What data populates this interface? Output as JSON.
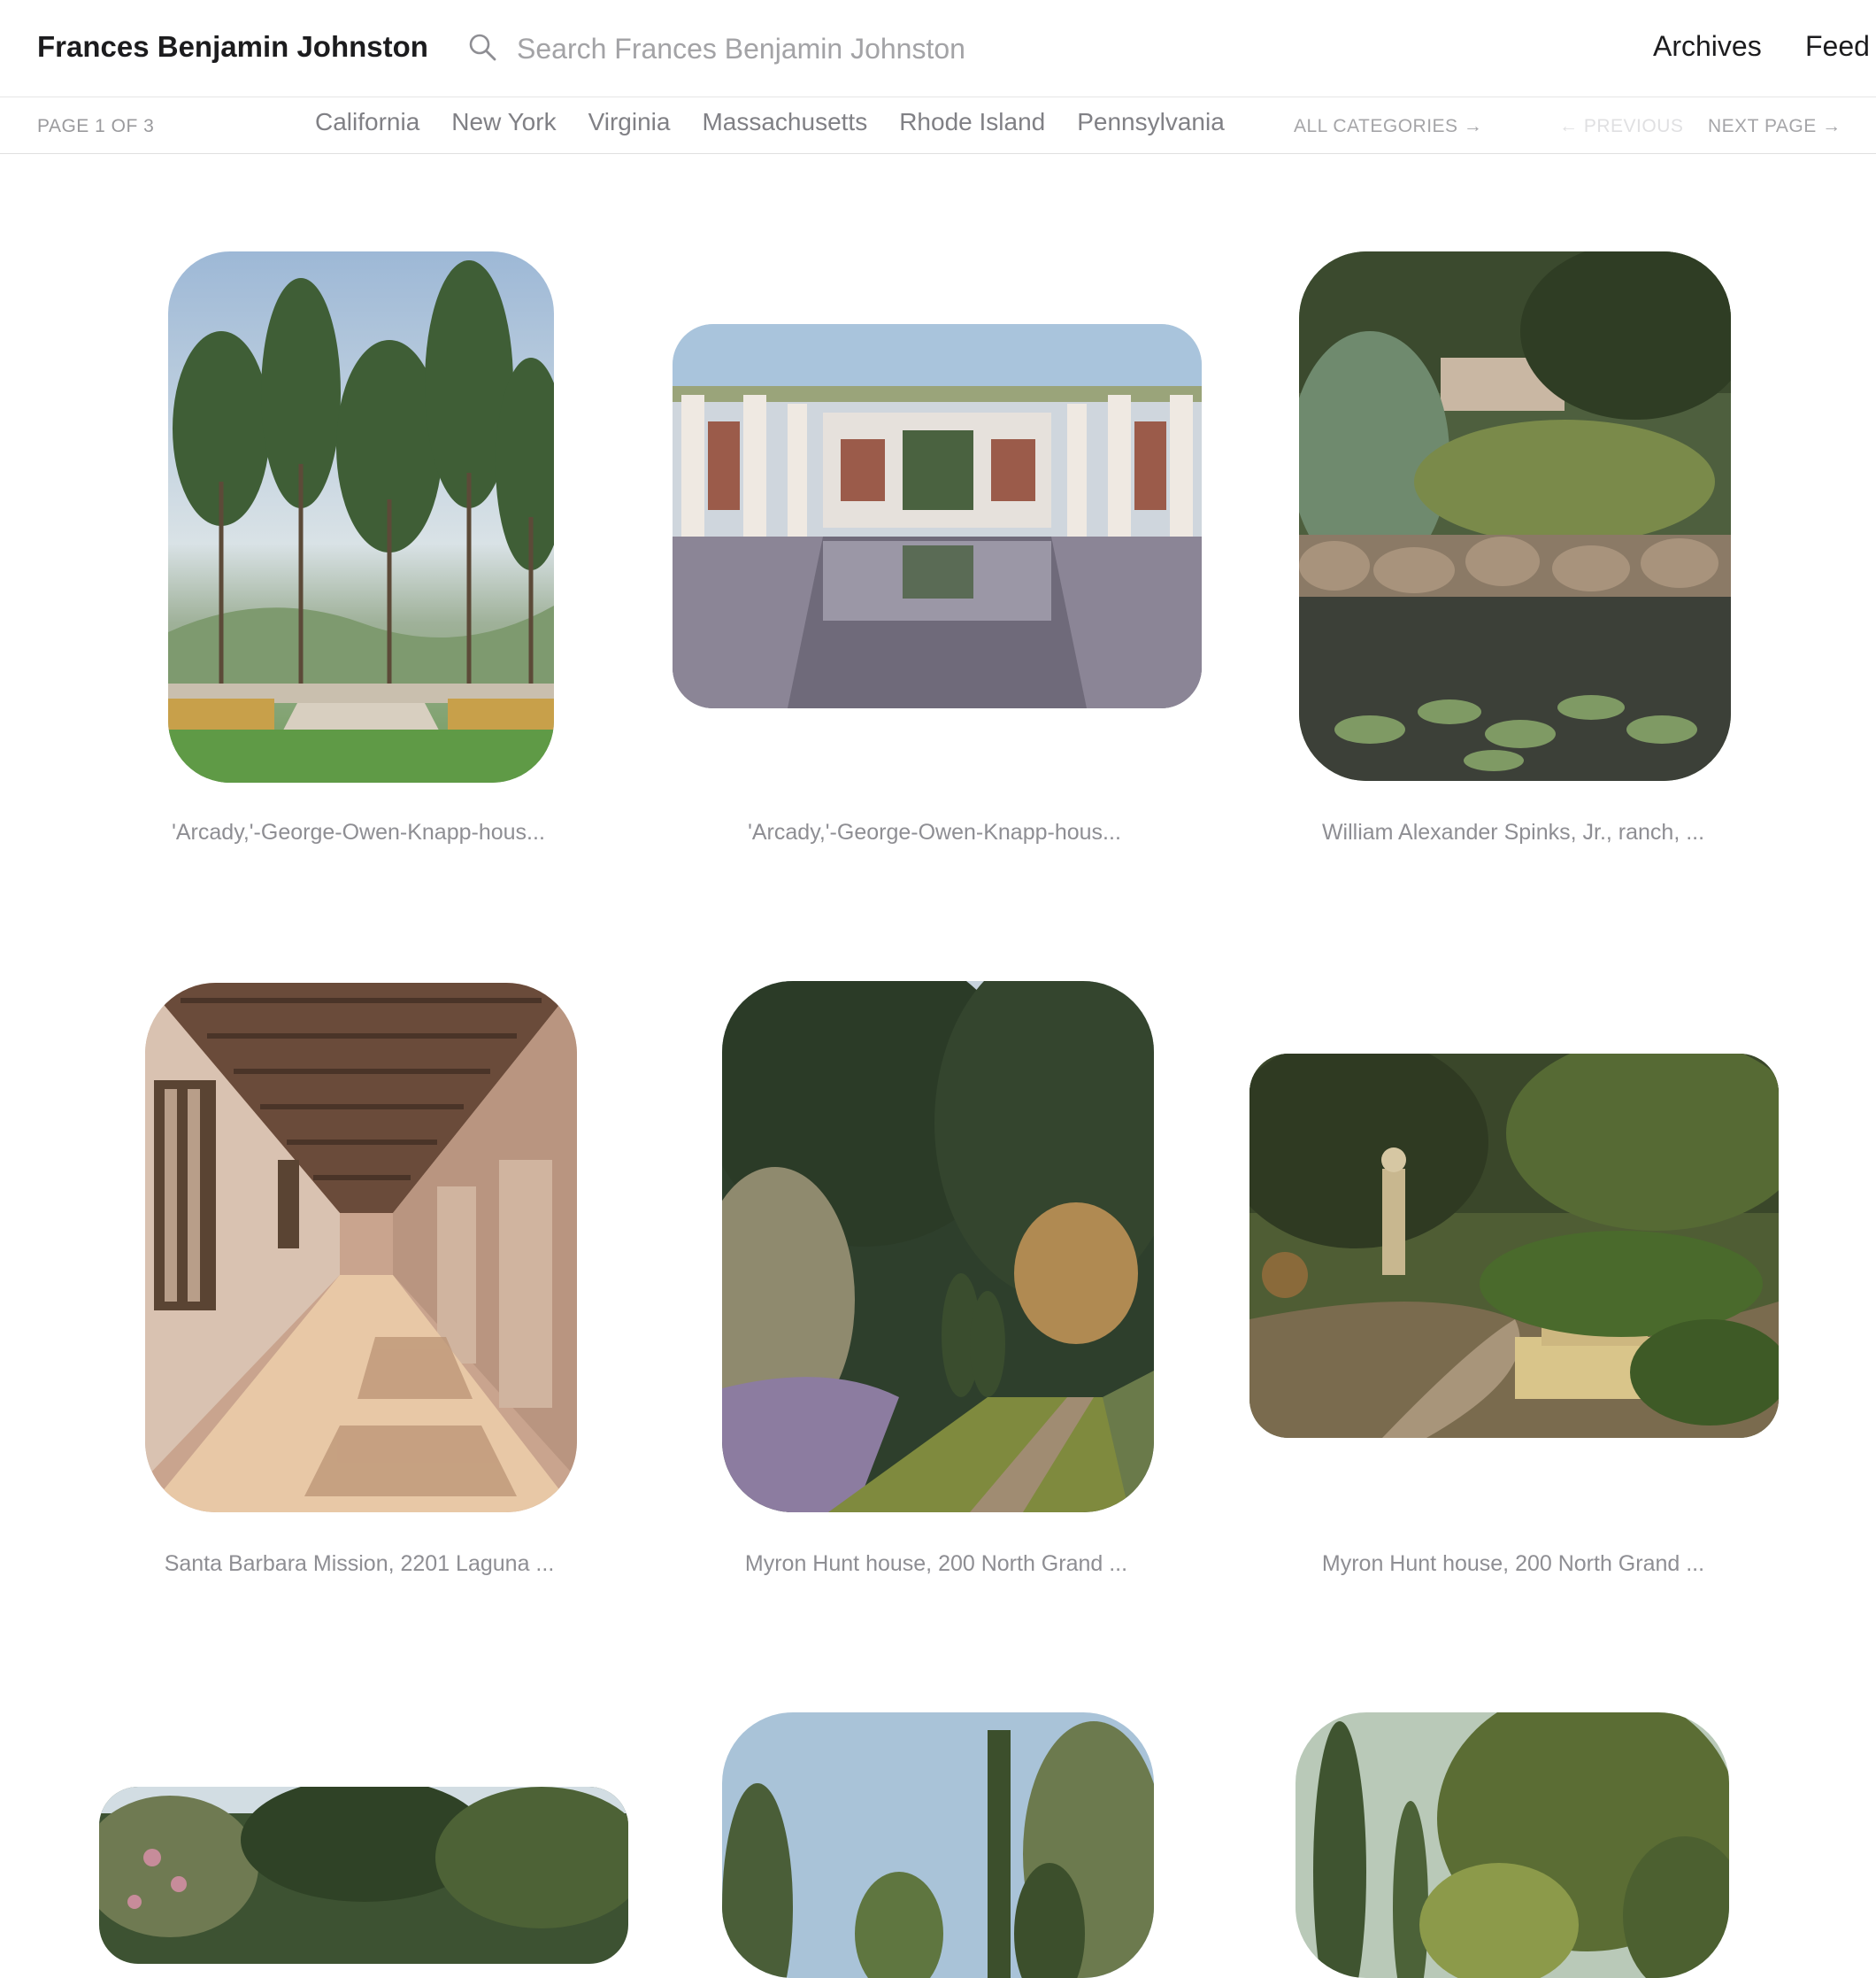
{
  "header": {
    "site_title": "Frances Benjamin Johnston",
    "search_placeholder": "Search Frances Benjamin Johnston",
    "links": [
      "Archives",
      "Feed"
    ]
  },
  "subnav": {
    "page_indicator": "PAGE 1 OF 3",
    "categories": [
      "California",
      "New York",
      "Virginia",
      "Massachusetts",
      "Rhode Island",
      "Pennsylvania"
    ],
    "all_categories": "ALL CATEGORIES →",
    "previous": "← PREVIOUS",
    "next": "NEXT PAGE →"
  },
  "gallery": [
    {
      "caption": "'Arcady,'-George-Owen-Knapp-hous..."
    },
    {
      "caption": "'Arcady,'-George-Owen-Knapp-hous..."
    },
    {
      "caption": "William Alexander Spinks, Jr., ranch, ..."
    },
    {
      "caption": "Santa Barbara Mission, 2201 Laguna ..."
    },
    {
      "caption": "Myron Hunt house, 200 North Grand ..."
    },
    {
      "caption": "Myron Hunt house, 200 North Grand ..."
    },
    {
      "caption": ""
    },
    {
      "caption": ""
    },
    {
      "caption": ""
    }
  ],
  "colors": {
    "title": "#1c1c1e",
    "muted": "#8e8e93",
    "divider": "#e0e0e0"
  }
}
